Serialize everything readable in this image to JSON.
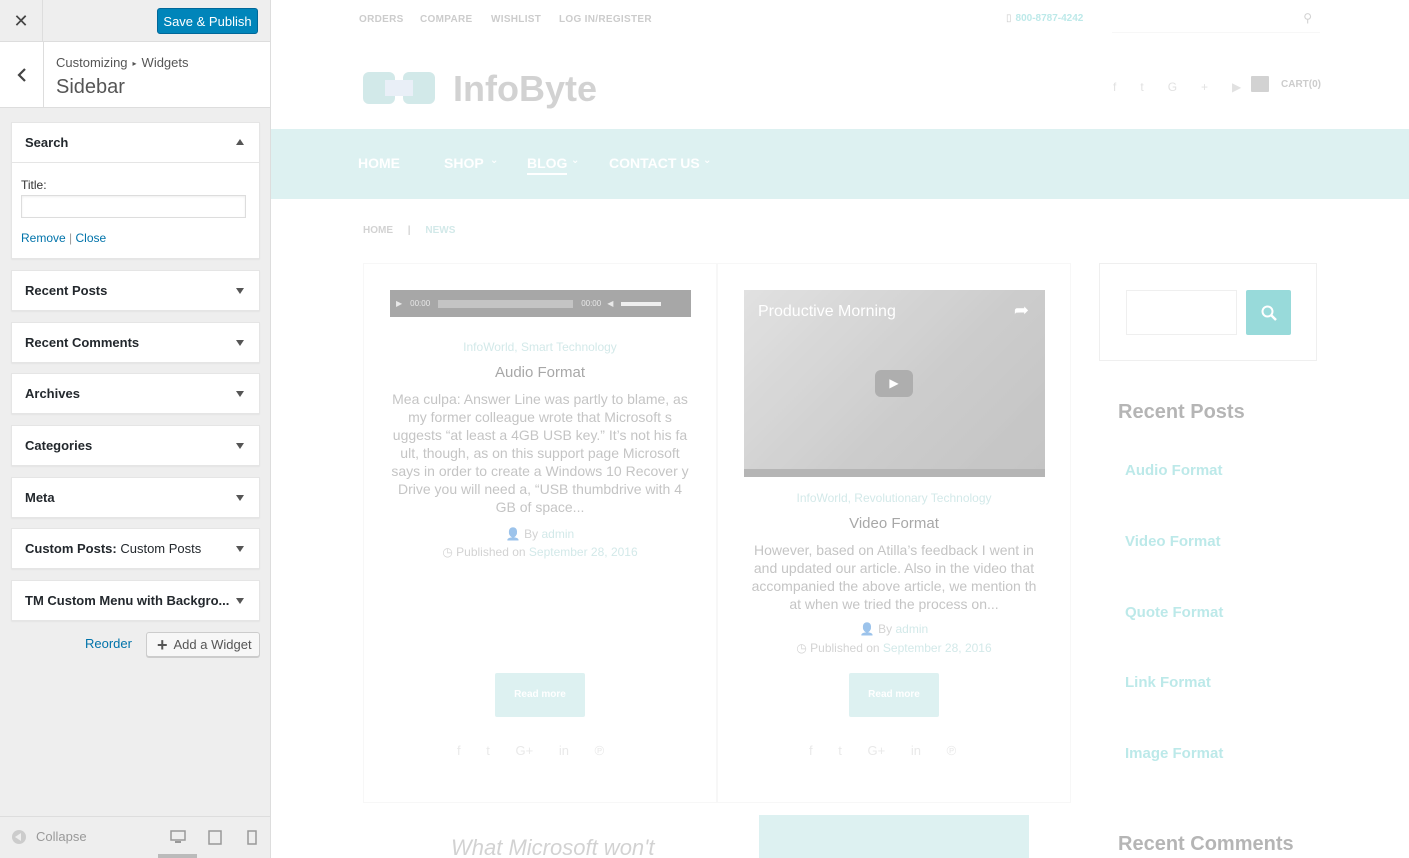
{
  "customizer": {
    "save_label": "Save & Publish",
    "breadcrumb": {
      "root": "Customizing",
      "current": "Widgets"
    },
    "section_title": "Sidebar",
    "widgets": [
      {
        "title": "Search",
        "subtitle": "",
        "expanded": true
      },
      {
        "title": "Recent Posts",
        "subtitle": "",
        "expanded": false
      },
      {
        "title": "Recent Comments",
        "subtitle": "",
        "expanded": false
      },
      {
        "title": "Archives",
        "subtitle": "",
        "expanded": false
      },
      {
        "title": "Categories",
        "subtitle": "",
        "expanded": false
      },
      {
        "title": "Meta",
        "subtitle": "",
        "expanded": false
      },
      {
        "title": "Custom Posts:",
        "subtitle": " Custom Posts",
        "expanded": false
      },
      {
        "title": "TM Custom Menu with Backgro...",
        "subtitle": "",
        "expanded": false
      }
    ],
    "search_widget": {
      "title_label": "Title:",
      "title_value": "",
      "remove_label": "Remove",
      "separator": "|",
      "close_label": "Close"
    },
    "reorder_label": "Reorder",
    "add_widget_label": "Add a Widget",
    "collapse_label": "Collapse"
  },
  "preview": {
    "top_links": [
      "ORDERS",
      "COMPARE",
      "WISHLIST",
      "LOG IN/REGISTER"
    ],
    "phone": "800-8787-4242",
    "cart_label": "CART(0)",
    "logo": "InfoByte",
    "nav": [
      "HOME",
      "SHOP",
      "BLOG",
      "CONTACT US"
    ],
    "breadcrumb": {
      "home": "HOME",
      "sep": "|",
      "current": "NEWS"
    },
    "posts": [
      {
        "categories": "InfoWorld, Smart Technology",
        "title": "Audio Format",
        "excerpt": "Mea culpa: Answer Line was partly to blame, as my former colleague wrote that Microsoft s uggests “at least a 4GB USB key.” It’s not his fa ult, though, as on this support page Microsoft says in order to create a Windows 10 Recover y Drive you will need a, “USB thumbdrive with 4 GB of space...",
        "by": "By",
        "author": "admin",
        "published": "Published on",
        "date": "September 28, 2016",
        "read_more": "Read more",
        "player_time_start": "00:00",
        "player_time_end": "00:00"
      },
      {
        "categories": "InfoWorld, Revolutionary Technology",
        "title": "Video Format",
        "excerpt": "However, based on Atilla’s feedback I went in and updated our article. Also in the video that accompanied the above article, we mention th at when we tried the process on...",
        "by": "By",
        "author": "admin",
        "published": "Published on",
        "date": "September 28, 2016",
        "read_more": "Read more",
        "video_title": "Productive Morning"
      }
    ],
    "recent_posts_title": "Recent Posts",
    "recent_posts": [
      "Audio Format",
      "Video Format",
      "Quote Format",
      "Link Format",
      "Image Format"
    ],
    "recent_comments_title": "Recent Comments",
    "bottom_text": "What Microsoft won't"
  },
  "colors": {
    "accent": "#0085ba",
    "link": "#0073aa",
    "teal": "#1aaaaa"
  }
}
